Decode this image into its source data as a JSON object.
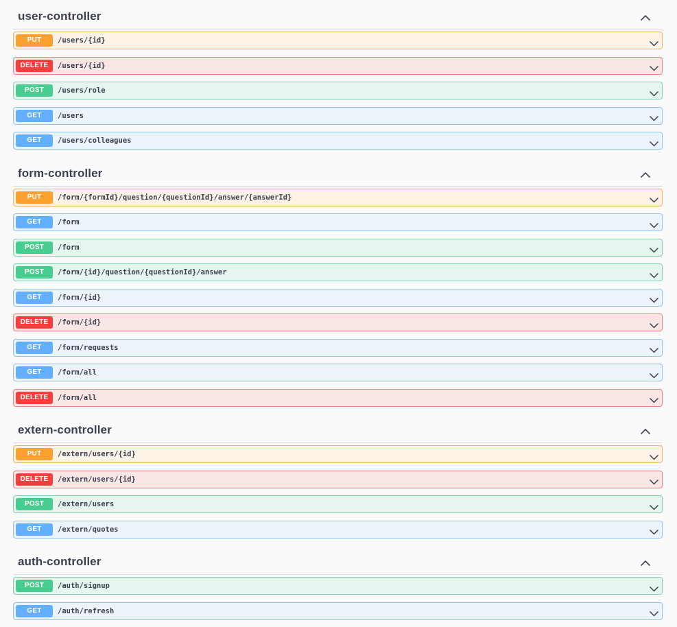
{
  "sections": [
    {
      "name": "user-controller",
      "toggle_icon": "chevron-up-icon",
      "operations": [
        {
          "method": "PUT",
          "path": "/users/{id}"
        },
        {
          "method": "DELETE",
          "path": "/users/{id}"
        },
        {
          "method": "POST",
          "path": "/users/role"
        },
        {
          "method": "GET",
          "path": "/users"
        },
        {
          "method": "GET",
          "path": "/users/colleagues"
        }
      ]
    },
    {
      "name": "form-controller",
      "toggle_icon": "chevron-up-icon",
      "operations": [
        {
          "method": "PUT",
          "path": "/form/{formId}/question/{questionId}/answer/{answerId}"
        },
        {
          "method": "GET",
          "path": "/form"
        },
        {
          "method": "POST",
          "path": "/form"
        },
        {
          "method": "POST",
          "path": "/form/{id}/question/{questionId}/answer"
        },
        {
          "method": "GET",
          "path": "/form/{id}"
        },
        {
          "method": "DELETE",
          "path": "/form/{id}"
        },
        {
          "method": "GET",
          "path": "/form/requests"
        },
        {
          "method": "GET",
          "path": "/form/all"
        },
        {
          "method": "DELETE",
          "path": "/form/all"
        }
      ]
    },
    {
      "name": "extern-controller",
      "toggle_icon": "chevron-up-icon",
      "operations": [
        {
          "method": "PUT",
          "path": "/extern/users/{id}"
        },
        {
          "method": "DELETE",
          "path": "/extern/users/{id}"
        },
        {
          "method": "POST",
          "path": "/extern/users"
        },
        {
          "method": "GET",
          "path": "/extern/quotes"
        }
      ]
    },
    {
      "name": "auth-controller",
      "toggle_icon": "chevron-up-icon",
      "operations": [
        {
          "method": "POST",
          "path": "/auth/signup"
        },
        {
          "method": "GET",
          "path": "/auth/refresh"
        }
      ]
    }
  ],
  "colors": {
    "PUT": "#fca130",
    "DELETE": "#f93e3e",
    "POST": "#49cc90",
    "GET": "#61affe"
  },
  "icons": {
    "section_toggle": "chevron-up-icon",
    "operation_toggle": "chevron-down-icon"
  }
}
